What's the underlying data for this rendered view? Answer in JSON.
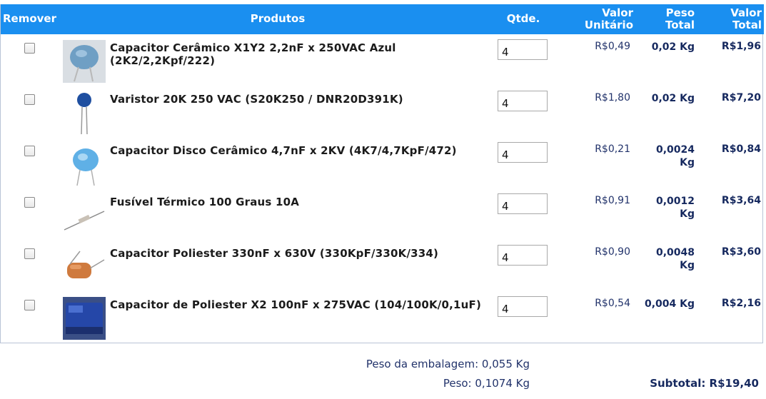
{
  "header": {
    "remove": "Remover",
    "products": "Produtos",
    "qty": "Qtde.",
    "unit_value_1": "Valor",
    "unit_value_2": "Unitário",
    "weight_1": "Peso",
    "weight_2": "Total",
    "total_1": "Valor",
    "total_2": "Total"
  },
  "items": [
    {
      "name": "Capacitor Cerâmico X1Y2 2,2nF x 250VAC Azul (2K2/2,2Kpf/222)",
      "qty": "4",
      "unit": "R$0,49",
      "weight": "0,02 Kg",
      "total": "R$1,96"
    },
    {
      "name": "Varistor 20K 250 VAC (S20K250 / DNR20D391K)",
      "qty": "4",
      "unit": "R$1,80",
      "weight": "0,02 Kg",
      "total": "R$7,20"
    },
    {
      "name": "Capacitor Disco Cerâmico 4,7nF x 2KV (4K7/4,7KpF/472)",
      "qty": "4",
      "unit": "R$0,21",
      "weight_1": "0,0024",
      "weight_2": "Kg",
      "total": "R$0,84"
    },
    {
      "name": "Fusível Térmico 100 Graus 10A",
      "qty": "4",
      "unit": "R$0,91",
      "weight_1": "0,0012",
      "weight_2": "Kg",
      "total": "R$3,64"
    },
    {
      "name": "Capacitor Poliester 330nF x 630V (330KpF/330K/334)",
      "qty": "4",
      "unit": "R$0,90",
      "weight_1": "0,0048",
      "weight_2": "Kg",
      "total": "R$3,60"
    },
    {
      "name": "Capacitor de Poliester X2 100nF x 275VAC (104/100K/0,1uF)",
      "qty": "4",
      "unit": "R$0,54",
      "weight": "0,004 Kg",
      "total": "R$2,16"
    }
  ],
  "footer": {
    "package_weight": "Peso da embalagem: 0,055 Kg",
    "weight": "Peso: 0,1074 Kg",
    "subtotal": "Subtotal: R$19,40"
  },
  "colors": {
    "header_bg": "#1a8ff0",
    "text_dark_blue": "#16295f"
  }
}
